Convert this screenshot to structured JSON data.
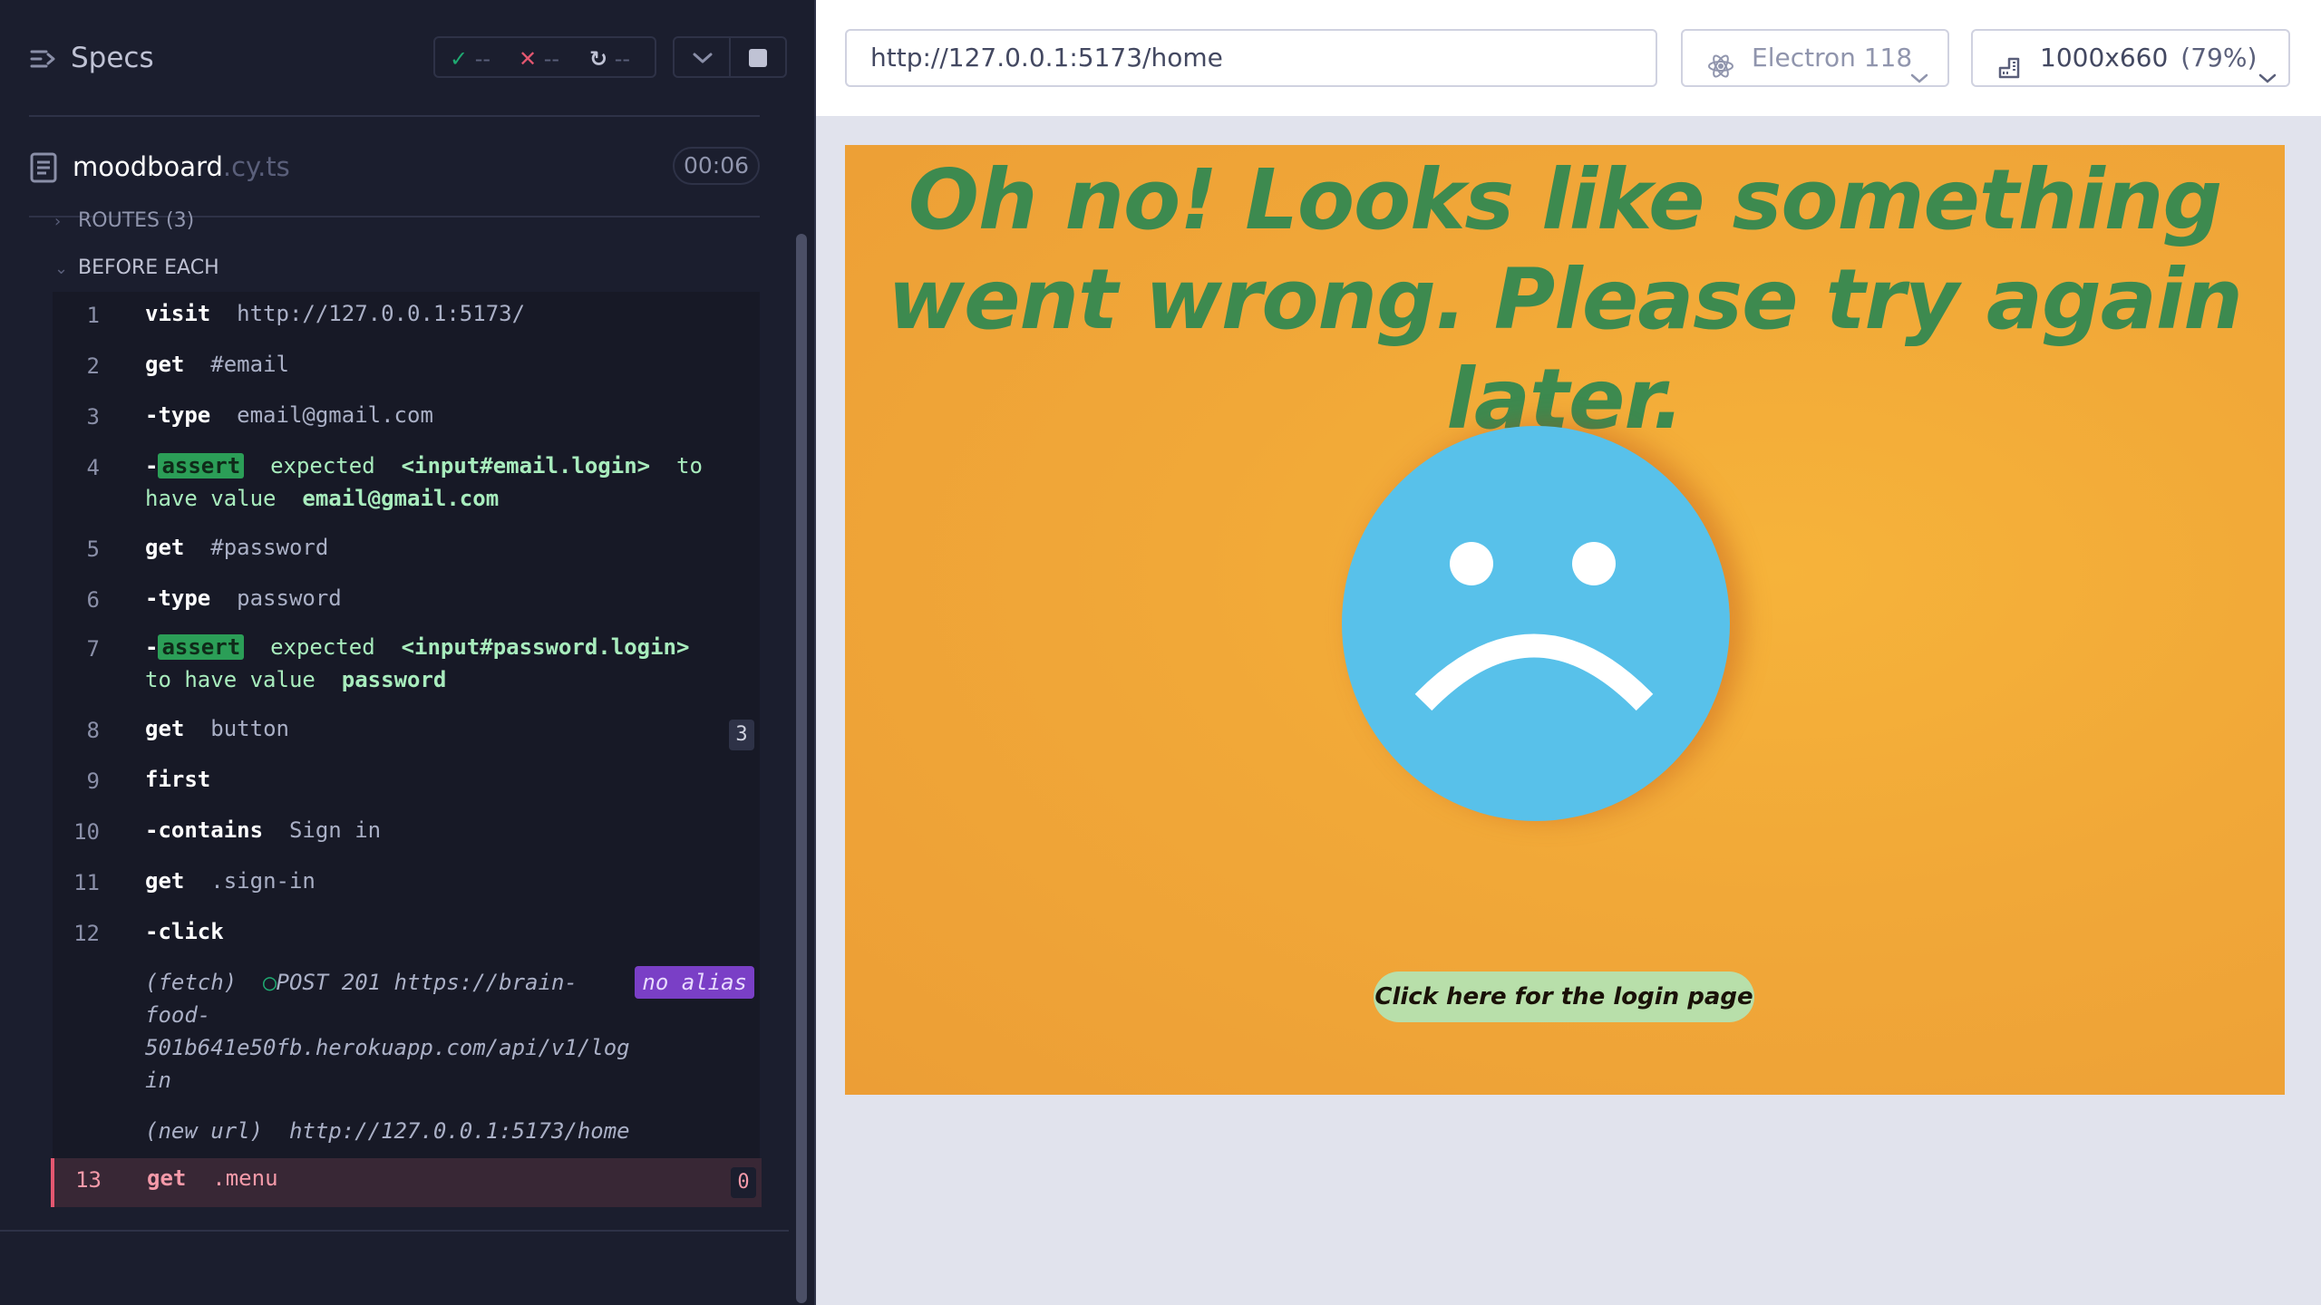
{
  "reporter": {
    "title": "Specs",
    "stats": {
      "passed_icon": "check-icon",
      "passed": "--",
      "failed_icon": "x-icon",
      "failed": "--",
      "pending_icon": "spinner-icon",
      "pending": "--"
    },
    "spec": {
      "name": "moodboard",
      "ext": ".cy.ts",
      "duration": "00:06"
    },
    "routes_label": "ROUTES (3)",
    "before_each_label": "BEFORE EACH",
    "commands": [
      {
        "num": "1",
        "name": "visit",
        "arg": "http://127.0.0.1:5173/"
      },
      {
        "num": "2",
        "name": "get",
        "arg": "#email"
      },
      {
        "num": "3",
        "name": "-type",
        "arg": "email@gmail.com"
      },
      {
        "num": "4",
        "tag": "assert",
        "w1": "expected",
        "w2": "<input#email.login>",
        "w3": "to",
        "w4": "have value",
        "w5": "email@gmail.com"
      },
      {
        "num": "5",
        "name": "get",
        "arg": "#password"
      },
      {
        "num": "6",
        "name": "-type",
        "arg": "password"
      },
      {
        "num": "7",
        "tag": "assert",
        "w1": "expected",
        "w2": "<input#password.login>",
        "w3": "to",
        "w4": "have value",
        "w5": "password"
      },
      {
        "num": "8",
        "name": "get",
        "arg": "button",
        "count": "3"
      },
      {
        "num": "9",
        "name": "first",
        "arg": ""
      },
      {
        "num": "10",
        "name": "-contains",
        "arg": "Sign in"
      },
      {
        "num": "11",
        "name": "get",
        "arg": ".sign-in"
      },
      {
        "num": "12",
        "name": "-click",
        "arg": ""
      },
      {
        "num": "13",
        "name": "get",
        "arg": ".menu",
        "count": "0"
      }
    ],
    "fetch": {
      "label": "(fetch)",
      "line1": "POST 201 https://brain-",
      "line2": "food-",
      "line3": "501b641e50fb.herokuapp.com/api/v1/log",
      "line4": "in",
      "alias": "no alias"
    },
    "new_url": {
      "label": "(new url)",
      "url": "http://127.0.0.1:5173/home"
    }
  },
  "aut": {
    "url": "http://127.0.0.1:5173/home",
    "browser": "Electron 118",
    "viewport": "1000x660",
    "zoom": "(79%)",
    "page": {
      "error_message": "Oh no! Looks like something went wrong. Please try again later.",
      "login_button": "Click here for the login page"
    }
  },
  "colors": {
    "pass": "#1fa971",
    "fail": "#e45770",
    "assert": "#2b9e57",
    "alias": "#7a3fc6",
    "error_text": "#3d8a4f",
    "face": "#58c1ea",
    "background_orange": "#f1a838"
  }
}
